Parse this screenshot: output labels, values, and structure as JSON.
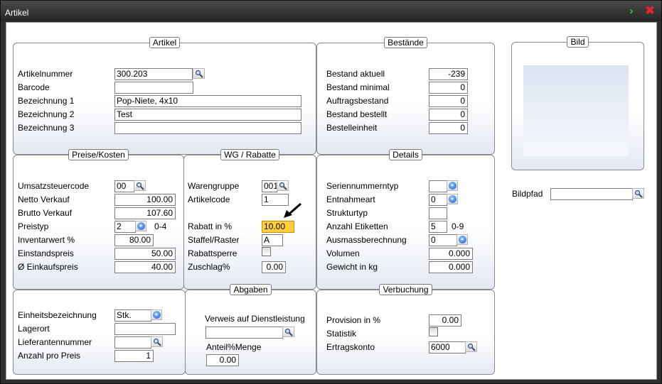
{
  "window": {
    "title": "Artikel"
  },
  "artikel": {
    "title": "Artikel",
    "artikelnummer_label": "Artikelnummer",
    "artikelnummer": "300.203",
    "barcode_label": "Barcode",
    "barcode": "",
    "bez1_label": "Bezeichnung 1",
    "bez1": "Pop-Niete,  4x10",
    "bez2_label": "Bezeichnung 2",
    "bez2": "Test",
    "bez3_label": "Bezeichnung 3",
    "bez3": ""
  },
  "bestaende": {
    "title": "Bestände",
    "aktuell_label": "Bestand aktuell",
    "aktuell": "-239",
    "minimal_label": "Bestand minimal",
    "minimal": "0",
    "auftrag_label": "Auftragsbestand",
    "auftrag": "0",
    "bestellt_label": "Bestand bestellt",
    "bestellt": "0",
    "einheit_label": "Bestelleinheit",
    "einheit": "0"
  },
  "bild": {
    "title": "Bild",
    "bildpfad_label": "Bildpfad",
    "bildpfad": ""
  },
  "preise": {
    "title": "Preise/Kosten",
    "ust_label": "Umsatzsteuercode",
    "ust": "00",
    "netto_label": "Netto Verkauf",
    "netto": "100.00",
    "brutto_label": "Brutto Verkauf",
    "brutto": "107.60",
    "preistyp_label": "Preistyp",
    "preistyp": "2",
    "preistyp_range": "0-4",
    "inventar_label": "Inventarwert %",
    "inventar": "80.00",
    "einstand_label": "Einstandspreis",
    "einstand": "50.00",
    "ek_label": "Ø Einkaufspreis",
    "ek": "40.00"
  },
  "wg": {
    "title": "WG / Rabatte",
    "wg_label": "Warengruppe",
    "wg": "001",
    "code_label": "Artikelcode",
    "code": "1",
    "rabatt_label": "Rabatt in %",
    "rabatt": "10.00",
    "staffel_label": "Staffel/Raster",
    "staffel": "A",
    "sperre_label": "Rabattsperre",
    "zuschlag_label": "Zuschlag%",
    "zuschlag": "0.00"
  },
  "details": {
    "title": "Details",
    "serien_label": "Seriennummerntyp",
    "serien": "",
    "entnahme_label": "Entnahmeart",
    "entnahme": "0",
    "struktur_label": "Strukturtyp",
    "struktur": "",
    "etiketten_label": "Anzahl Etiketten",
    "etiketten": "5",
    "etiketten_range": "0-9",
    "ausmass_label": "Ausmassberechnung",
    "ausmass": "0",
    "volumen_label": "Volumen",
    "volumen": "0.000",
    "gewicht_label": "Gewicht in kg",
    "gewicht": "0.000"
  },
  "lager": {
    "einheit_label": "Einheitsbezeichnung",
    "einheit": "Stk.",
    "lagerort_label": "Lagerort",
    "lagerort": "",
    "lief_label": "Lieferantennummer",
    "lief": "",
    "anzahl_label": "Anzahl pro Preis",
    "anzahl": "1"
  },
  "abgaben": {
    "title": "Abgaben",
    "verweis_label": "Verweis auf Dienstleistung",
    "verweis": "",
    "anteil_label": "Anteil%Menge",
    "anteil": "0.00"
  },
  "verbuchung": {
    "title": "Verbuchung",
    "provision_label": "Provision in %",
    "provision": "0.00",
    "statistik_label": "Statistik",
    "ertrag_label": "Ertragskonto",
    "ertrag": "6000"
  },
  "colors": {
    "highlight": "#ffcf3d",
    "dropdown": "#1d5fcf",
    "close": "#e4252f",
    "next": "#39c24a"
  }
}
